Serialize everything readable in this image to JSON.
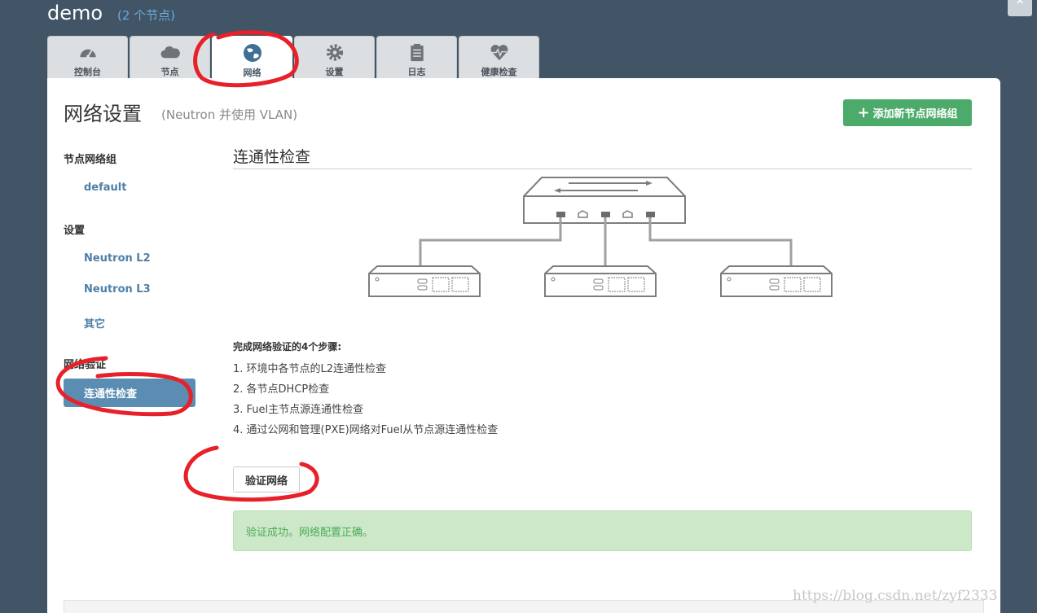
{
  "header": {
    "env_name": "demo",
    "env_nodes": "(2 个节点)"
  },
  "tabs": [
    {
      "label": "控制台",
      "icon": "dashboard-icon",
      "active": false
    },
    {
      "label": "节点",
      "icon": "cloud-icon",
      "active": false
    },
    {
      "label": "网络",
      "icon": "globe-icon",
      "active": true
    },
    {
      "label": "设置",
      "icon": "gear-icon",
      "active": false
    },
    {
      "label": "日志",
      "icon": "clipboard-icon",
      "active": false
    },
    {
      "label": "健康检查",
      "icon": "heartbeat-icon",
      "active": false
    }
  ],
  "page": {
    "title": "网络设置",
    "subtitle": "(Neutron 并使用 VLAN)",
    "add_button": "添加新节点网络组"
  },
  "sidebar": {
    "group_heading": "节点网络组",
    "groups": [
      "default"
    ],
    "settings_heading": "设置",
    "settings": [
      "Neutron L2",
      "Neutron L3",
      "其它"
    ],
    "verify_heading": "网络验证",
    "verify_item": "连通性检查"
  },
  "section": {
    "title": "连通性检查",
    "steps_title": "完成网络验证的4个步骤:",
    "steps": [
      "1. 环境中各节点的L2连通性检查",
      "2. 各节点DHCP检查",
      "3. Fuel主节点源连通性检查",
      "4. 通过公网和管理(PXE)网络对Fuel从节点源连通性检查"
    ],
    "verify_button": "验证网络",
    "alert": "验证成功。网络配置正确。"
  },
  "watermark": "https://blog.csdn.net/zyf2333",
  "colors": {
    "background": "#415566",
    "accent_blue": "#5b8cb2",
    "success_green": "#4cab6a",
    "alert_bg": "#cce8c8",
    "annotation_red": "#e8202a"
  }
}
